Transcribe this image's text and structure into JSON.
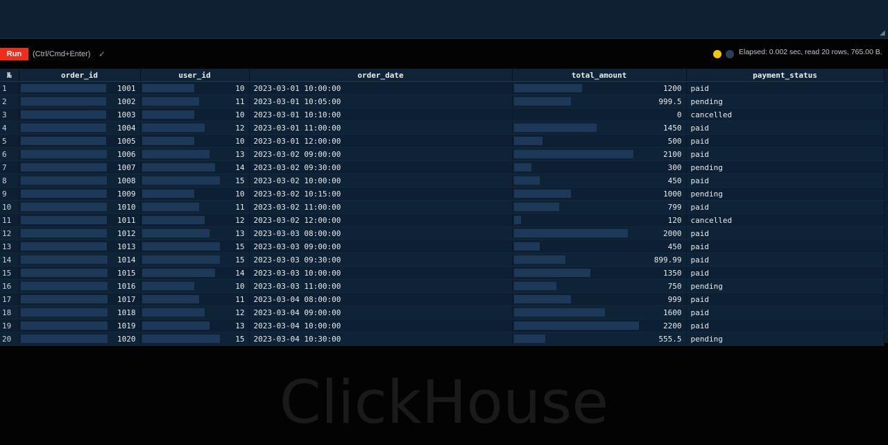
{
  "toolbar": {
    "run_label": "Run",
    "shortcut_hint": "(Ctrl/Cmd+Enter)",
    "status_icon": "check-icon",
    "stats": "Elapsed: 0.002 sec, read 20 rows, 765.00 B."
  },
  "colors": {
    "run_button": "#ee2e1b",
    "table_background": "#0d1f33",
    "bar": "#1d3957"
  },
  "table": {
    "row_number_header": "№",
    "columns": [
      "order_id",
      "user_id",
      "order_date",
      "total_amount",
      "payment_status"
    ],
    "bar_columns": {
      "order_id": {
        "min": 0,
        "max": 1020
      },
      "user_id": {
        "min": 0,
        "max": 15
      },
      "total_amount": {
        "min": 0,
        "max": 2200
      }
    },
    "rows": [
      {
        "n": "1",
        "order_id": "1001",
        "user_id": "10",
        "order_date": "2023-03-01 10:00:00",
        "total_amount": "1200",
        "payment_status": "paid"
      },
      {
        "n": "2",
        "order_id": "1002",
        "user_id": "11",
        "order_date": "2023-03-01 10:05:00",
        "total_amount": "999.5",
        "payment_status": "pending"
      },
      {
        "n": "3",
        "order_id": "1003",
        "user_id": "10",
        "order_date": "2023-03-01 10:10:00",
        "total_amount": "0",
        "payment_status": "cancelled"
      },
      {
        "n": "4",
        "order_id": "1004",
        "user_id": "12",
        "order_date": "2023-03-01 11:00:00",
        "total_amount": "1450",
        "payment_status": "paid"
      },
      {
        "n": "5",
        "order_id": "1005",
        "user_id": "10",
        "order_date": "2023-03-01 12:00:00",
        "total_amount": "500",
        "payment_status": "paid"
      },
      {
        "n": "6",
        "order_id": "1006",
        "user_id": "13",
        "order_date": "2023-03-02 09:00:00",
        "total_amount": "2100",
        "payment_status": "paid"
      },
      {
        "n": "7",
        "order_id": "1007",
        "user_id": "14",
        "order_date": "2023-03-02 09:30:00",
        "total_amount": "300",
        "payment_status": "pending"
      },
      {
        "n": "8",
        "order_id": "1008",
        "user_id": "15",
        "order_date": "2023-03-02 10:00:00",
        "total_amount": "450",
        "payment_status": "paid"
      },
      {
        "n": "9",
        "order_id": "1009",
        "user_id": "10",
        "order_date": "2023-03-02 10:15:00",
        "total_amount": "1000",
        "payment_status": "pending"
      },
      {
        "n": "10",
        "order_id": "1010",
        "user_id": "11",
        "order_date": "2023-03-02 11:00:00",
        "total_amount": "799",
        "payment_status": "paid"
      },
      {
        "n": "11",
        "order_id": "1011",
        "user_id": "12",
        "order_date": "2023-03-02 12:00:00",
        "total_amount": "120",
        "payment_status": "cancelled"
      },
      {
        "n": "12",
        "order_id": "1012",
        "user_id": "13",
        "order_date": "2023-03-03 08:00:00",
        "total_amount": "2000",
        "payment_status": "paid"
      },
      {
        "n": "13",
        "order_id": "1013",
        "user_id": "15",
        "order_date": "2023-03-03 09:00:00",
        "total_amount": "450",
        "payment_status": "paid"
      },
      {
        "n": "14",
        "order_id": "1014",
        "user_id": "15",
        "order_date": "2023-03-03 09:30:00",
        "total_amount": "899.99",
        "payment_status": "paid"
      },
      {
        "n": "15",
        "order_id": "1015",
        "user_id": "14",
        "order_date": "2023-03-03 10:00:00",
        "total_amount": "1350",
        "payment_status": "paid"
      },
      {
        "n": "16",
        "order_id": "1016",
        "user_id": "10",
        "order_date": "2023-03-03 11:00:00",
        "total_amount": "750",
        "payment_status": "pending"
      },
      {
        "n": "17",
        "order_id": "1017",
        "user_id": "11",
        "order_date": "2023-03-04 08:00:00",
        "total_amount": "999",
        "payment_status": "paid"
      },
      {
        "n": "18",
        "order_id": "1018",
        "user_id": "12",
        "order_date": "2023-03-04 09:00:00",
        "total_amount": "1600",
        "payment_status": "paid"
      },
      {
        "n": "19",
        "order_id": "1019",
        "user_id": "13",
        "order_date": "2023-03-04 10:00:00",
        "total_amount": "2200",
        "payment_status": "paid"
      },
      {
        "n": "20",
        "order_id": "1020",
        "user_id": "15",
        "order_date": "2023-03-04 10:30:00",
        "total_amount": "555.5",
        "payment_status": "pending"
      }
    ]
  },
  "watermark": "ClickHouse"
}
